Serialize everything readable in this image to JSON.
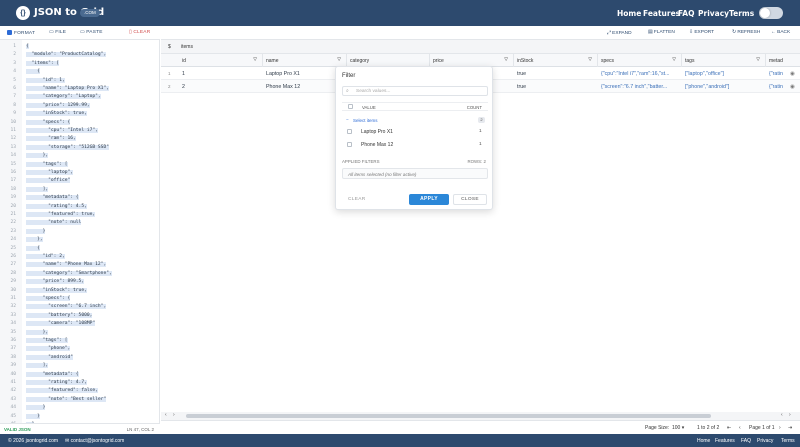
{
  "header": {
    "logo_mark": "{}",
    "app_name": "JSON to Grid",
    "badge": ".COM",
    "nav": [
      "Home",
      "Features",
      "FAQ",
      "Privacy",
      "Terms"
    ]
  },
  "left_toolbar": {
    "format": "FORMAT",
    "file": "FILE",
    "paste": "PASTE",
    "clear": "CLEAR"
  },
  "right_toolbar": {
    "expand": "EXPAND",
    "flatten": "FLATTEN",
    "export": "EXPORT",
    "refresh": "REFRESH",
    "back": "BACK"
  },
  "editor": {
    "lines": [
      "{",
      "  \"module\": \"ProductCatalog\",",
      "  \"items\": [",
      "    {",
      "      \"id\": 1,",
      "      \"name\": \"Laptop Pro X1\",",
      "      \"category\": \"Laptop\",",
      "      \"price\": 1299.99,",
      "      \"inStock\": true,",
      "      \"specs\": {",
      "        \"cpu\": \"Intel i7\",",
      "        \"ram\": 16,",
      "        \"storage\": \"512GB SSD\"",
      "      },",
      "      \"tags\": [",
      "        \"laptop\",",
      "        \"office\"",
      "      ],",
      "      \"metadata\": {",
      "        \"rating\": 4.5,",
      "        \"featured\": true,",
      "        \"note\": null",
      "      }",
      "    },",
      "    {",
      "      \"id\": 2,",
      "      \"name\": \"Phone Max 12\",",
      "      \"category\": \"Smartphone\",",
      "      \"price\": 899.5,",
      "      \"inStock\": true,",
      "      \"specs\": {",
      "        \"screen\": \"6.7 inch\",",
      "        \"battery\": 5000,",
      "        \"camera\": \"108MP\"",
      "      },",
      "      \"tags\": [",
      "        \"phone\",",
      "        \"android\"",
      "      ],",
      "      \"metadata\": {",
      "        \"rating\": 4.7,",
      "        \"featured\": false,",
      "        \"note\": \"Best seller\"",
      "      }",
      "    }",
      "  ]"
    ],
    "status_valid": "VALID JSON",
    "cursor": "LN 47, COL 2"
  },
  "breadcrumb": {
    "root": "$",
    "path": "items"
  },
  "grid": {
    "columns": [
      "id",
      "name",
      "category",
      "price",
      "inStock",
      "specs",
      "tags",
      "metad"
    ],
    "rows": [
      {
        "n": "1",
        "id": "1",
        "name": "Laptop Pro X1",
        "inStock": "true",
        "specs": "{\"cpu\":\"Intel i7\",\"ram\":16,\"st...",
        "tags": "[\"laptop\",\"office\"]",
        "meta": "{\"ratin"
      },
      {
        "n": "2",
        "id": "2",
        "name": "Phone Max 12",
        "inStock": "true",
        "specs": "{\"screen\":\"6.7 inch\",\"batter...",
        "tags": "[\"phone\",\"android\"]",
        "meta": "{\"ratin"
      }
    ]
  },
  "filter_popup": {
    "title": "Filter",
    "search_placeholder": "Search values...",
    "col_value": "VALUE",
    "col_count": "COUNT",
    "select_items": "Select items",
    "select_count": "2",
    "items": [
      {
        "label": "Laptop Pro X1",
        "count": "1"
      },
      {
        "label": "Phone Max 12",
        "count": "1"
      }
    ],
    "applied_label": "APPLIED FILTERS",
    "rows_label": "ROWS: 2",
    "applied_text": "All items selected (no filter active)",
    "clear": "CLEAR",
    "apply": "APPLY",
    "close": "CLOSE"
  },
  "pager": {
    "page_size_label": "Page Size:",
    "page_size": "100",
    "range": "1 to 2 of 2",
    "page_label": "Page 1 of 1"
  },
  "footer": {
    "copyright": "© 2026 jsontogrid.com",
    "email": "contact@jsontogrid.com",
    "links": [
      "Home",
      "Features",
      "FAQ",
      "Privacy",
      "Terms"
    ]
  },
  "colors": {
    "header_bg": "#2d4a6e",
    "apply_btn": "#2b87d8",
    "valid_green": "#2f9c5a",
    "clear_red": "#d04a4a"
  }
}
